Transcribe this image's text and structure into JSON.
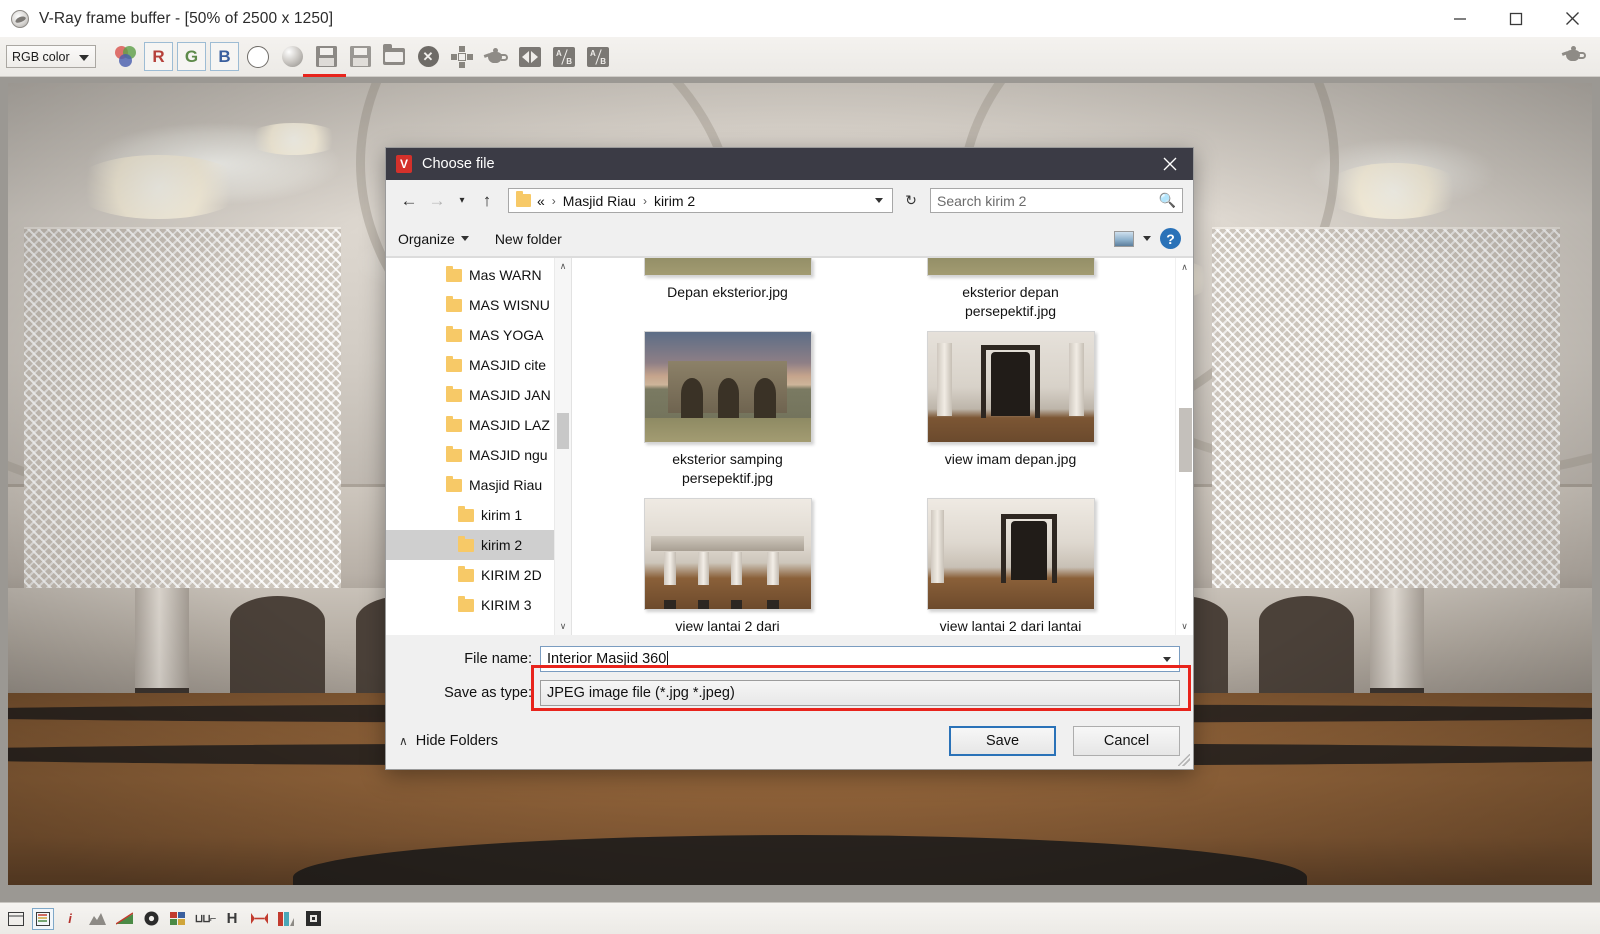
{
  "window": {
    "title": "V-Ray frame buffer - [50% of 2500 x 1250]",
    "app_icon": "vray-logo-icon",
    "controls": {
      "minimize": "minimize-button",
      "maximize": "maximize-button",
      "close": "close-button"
    }
  },
  "toolbar": {
    "channel_select": {
      "value": "RGB color",
      "caret": "chevron-down-icon"
    },
    "buttons": [
      {
        "name": "color-channels-icon",
        "label": ""
      },
      {
        "name": "red-channel-button",
        "label": "R"
      },
      {
        "name": "green-channel-button",
        "label": "G"
      },
      {
        "name": "blue-channel-button",
        "label": "B"
      },
      {
        "name": "alpha-channel-button",
        "label": ""
      },
      {
        "name": "monochrome-button",
        "label": ""
      },
      {
        "name": "save-image-button",
        "label": ""
      },
      {
        "name": "save-all-channels-button",
        "label": ""
      },
      {
        "name": "load-image-button",
        "label": ""
      },
      {
        "name": "clear-image-button",
        "label": ""
      },
      {
        "name": "region-render-button",
        "label": ""
      },
      {
        "name": "track-mouse-button",
        "label": ""
      },
      {
        "name": "compare-horizontal-button",
        "label": ""
      },
      {
        "name": "compare-ab-button",
        "label": ""
      },
      {
        "name": "compare-ab-vertical-button",
        "label": ""
      }
    ],
    "highlight_color": "#e8241c",
    "highlighted_button": "save-image-button"
  },
  "statusbar": {
    "icons": [
      "render-history-icon",
      "vfb-settings-icon",
      "image-info-icon",
      "horizontal-curve-icon",
      "color-corrections-icon",
      "exposure-icon",
      "color-balance-icon",
      "curve-icon",
      "hue-saturation-icon",
      "white-balance-icon",
      "lut-icon",
      "ocio-icon"
    ]
  },
  "dialog": {
    "title": "Choose file",
    "title_icon": "vray-app-icon",
    "close_label": "×",
    "nav": {
      "back": "back-arrow-icon",
      "forward": "forward-arrow-icon",
      "recent": "chevron-down-icon",
      "up": "up-arrow-icon",
      "breadcrumbs": [
        "«",
        "Masjid Riau",
        "kirim 2"
      ],
      "breadcrumb_separator": "›",
      "address_caret": "chevron-down-icon",
      "refresh": "refresh-icon",
      "search_placeholder": "Search kirim 2",
      "search_value": "",
      "search_icon": "magnifier-icon"
    },
    "commandbar": {
      "organize": "Organize",
      "new_folder": "New folder",
      "view_icon": "view-mode-icon",
      "view_caret": "chevron-down-icon",
      "help": "?"
    },
    "tree": {
      "items": [
        {
          "label": "Mas WARN",
          "level": 0,
          "selected": false
        },
        {
          "label": "MAS WISNU",
          "level": 0,
          "selected": false
        },
        {
          "label": "MAS YOGA",
          "level": 0,
          "selected": false
        },
        {
          "label": "MASJID cite",
          "level": 0,
          "selected": false
        },
        {
          "label": "MASJID JAN",
          "level": 0,
          "selected": false
        },
        {
          "label": "MASJID LAZ",
          "level": 0,
          "selected": false
        },
        {
          "label": "MASJID ngu",
          "level": 0,
          "selected": false
        },
        {
          "label": "Masjid Riau",
          "level": 0,
          "selected": false
        },
        {
          "label": "kirim 1",
          "level": 1,
          "selected": false
        },
        {
          "label": "kirim 2",
          "level": 1,
          "selected": true
        },
        {
          "label": "KIRIM 2D",
          "level": 1,
          "selected": false
        },
        {
          "label": "KIRIM 3",
          "level": 1,
          "selected": false
        }
      ],
      "scroll_up": "∧",
      "scroll_down": "∨"
    },
    "files": {
      "rows": [
        [
          {
            "label": "Depan eksterior.jpg",
            "thumb": "exterior-front-thumb",
            "clipped": true
          },
          {
            "label": "eksterior depan persepektif.jpg",
            "thumb": "exterior-front-perspective-thumb",
            "clipped": true
          }
        ],
        [
          {
            "label": "eksterior samping persepektif.jpg",
            "thumb": "exterior-side-perspective-thumb",
            "clipped": false
          },
          {
            "label": "view imam depan.jpg",
            "thumb": "imam-front-view-thumb",
            "clipped": false
          }
        ],
        [
          {
            "label": "view lantai 2 dari",
            "thumb": "floor2-view-thumb",
            "clipped": false
          },
          {
            "label": "view lantai 2 dari lantai",
            "thumb": "floor2-from-floor-thumb",
            "clipped": false
          }
        ]
      ],
      "scroll_up": "∧",
      "scroll_down": "∨"
    },
    "bottom": {
      "file_name_label": "File name:",
      "file_name_value": "Interior Masjid 360",
      "file_name_caret": "chevron-down-icon",
      "save_as_type_label": "Save as type:",
      "save_as_type_value": "JPEG image file (*.jpg *.jpeg)",
      "save_as_type_caret": "chevron-down-icon",
      "highlight_color": "#e8241c"
    },
    "footer": {
      "hide_folders": "Hide Folders",
      "hide_folders_caret": "∧",
      "save": "Save",
      "cancel": "Cancel"
    }
  }
}
